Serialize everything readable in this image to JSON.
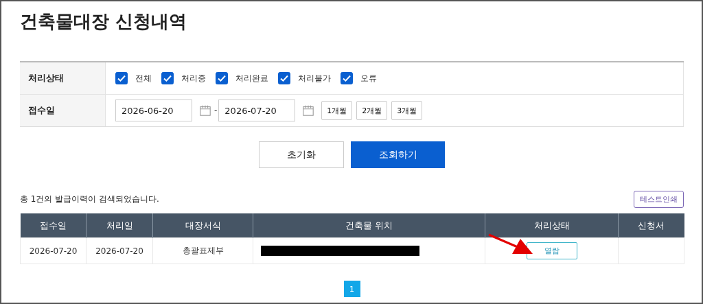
{
  "title": "건축물대장 신청내역",
  "filter": {
    "status_label": "처리상태",
    "statuses": [
      {
        "label": "전체",
        "checked": true
      },
      {
        "label": "처리중",
        "checked": true
      },
      {
        "label": "처리완료",
        "checked": true
      },
      {
        "label": "처리불가",
        "checked": true
      },
      {
        "label": "오류",
        "checked": true
      }
    ],
    "date_label": "접수일",
    "date_from": "2026-06-20",
    "date_separator": "-",
    "date_to": "2026-07-20",
    "periods": [
      "1개월",
      "2개월",
      "3개월"
    ]
  },
  "actions": {
    "reset": "초기화",
    "search": "조회하기"
  },
  "summary": "총 1건의 발급이력이 검색되었습니다.",
  "test_print": "테스트인쇄",
  "table": {
    "columns": [
      "접수일",
      "처리일",
      "대장서식",
      "건축물 위치",
      "처리상태",
      "신청서"
    ],
    "rows": [
      [
        {
          "kind": "text",
          "text": "2026-07-20"
        },
        {
          "kind": "text",
          "text": "2026-07-20"
        },
        {
          "kind": "text",
          "text": "총괄표제부"
        },
        {
          "kind": "redacted"
        },
        {
          "kind": "button",
          "text": "열람"
        },
        {
          "kind": "empty"
        }
      ]
    ]
  },
  "pagination": [
    {
      "label": "1",
      "selected": true
    }
  ]
}
